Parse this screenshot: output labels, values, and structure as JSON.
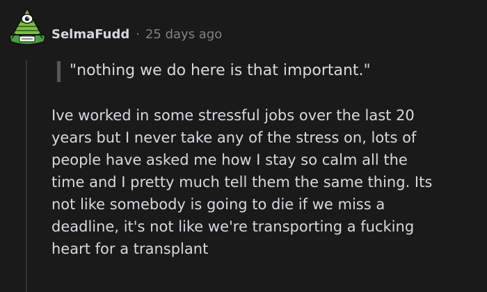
{
  "comment": {
    "author": "SelmaFudd",
    "separator": "·",
    "timestamp": "25 days ago",
    "avatar": "pyramid-eye-avatar-icon",
    "quote": "\"nothing we do here is that important.\"",
    "body_lines": [
      "Ive worked in some stressful jobs over the last 20",
      "years but I never take any of the stress on, lots of",
      "people have asked me how I stay so calm all the",
      "time and I pretty much tell them the same thing. Its",
      "not like somebody is going to die if we miss a",
      "deadline, it's not like we're transporting a fucking",
      "heart for a transplant"
    ]
  },
  "colors": {
    "background": "#1a1a1b",
    "text": "#d7dadc",
    "meta": "#818384",
    "thread_line": "#343536",
    "quote_bar": "#575859",
    "avatar_green": "#4a9e3f"
  }
}
